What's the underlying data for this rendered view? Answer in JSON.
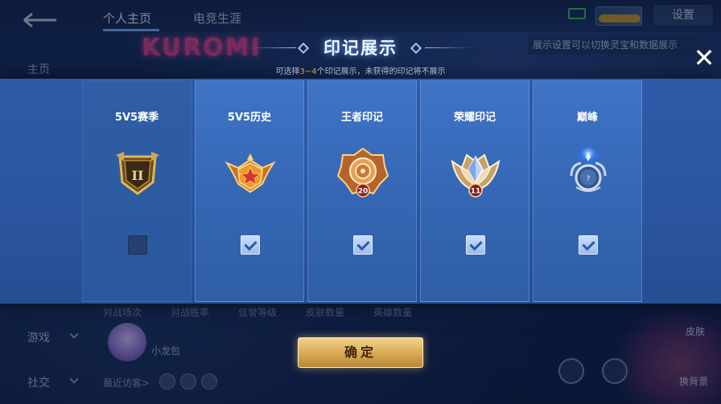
{
  "background": {
    "tabs": [
      "个人主页",
      "电竞生涯"
    ],
    "settings_label": "设置",
    "tip": "展示设置可以切换灵宝和数据展示",
    "neon_text": "KUROMI",
    "nav": {
      "home": "主页",
      "game": "游戏",
      "social": "社交"
    },
    "stats_labels": [
      "对战场次",
      "对战胜率",
      "信誉等级",
      "皮肤数量",
      "英雄数量"
    ],
    "player_name": "小龙包",
    "visitors_label": "最近访客>",
    "side_labels": [
      "皮肤",
      "换背景"
    ]
  },
  "modal": {
    "title": "印记展示",
    "subtitle_prefix": "可选择",
    "subtitle_range": "3~4",
    "subtitle_suffix": "个印记展示，未获得的印记将不展示",
    "close_symbol": "✕",
    "confirm_label": "确定",
    "columns": [
      {
        "label": "5V5赛季",
        "emblem": "season-shield-emblem",
        "badge": "II",
        "checked": false
      },
      {
        "label": "5V5历史",
        "emblem": "history-star-emblem",
        "badge": "",
        "checked": true
      },
      {
        "label": "王者印记",
        "emblem": "king-medal-emblem",
        "badge": "20",
        "checked": true
      },
      {
        "label": "荣耀印记",
        "emblem": "glory-crystal-emblem",
        "badge": "11",
        "checked": true
      },
      {
        "label": "巅峰",
        "emblem": "peak-unknown-emblem",
        "badge": "?",
        "checked": true
      }
    ]
  },
  "colors": {
    "accent_gold": "#d9ac56",
    "highlight_orange": "#f3b04a",
    "panel_blue": "#2d5ba8"
  }
}
